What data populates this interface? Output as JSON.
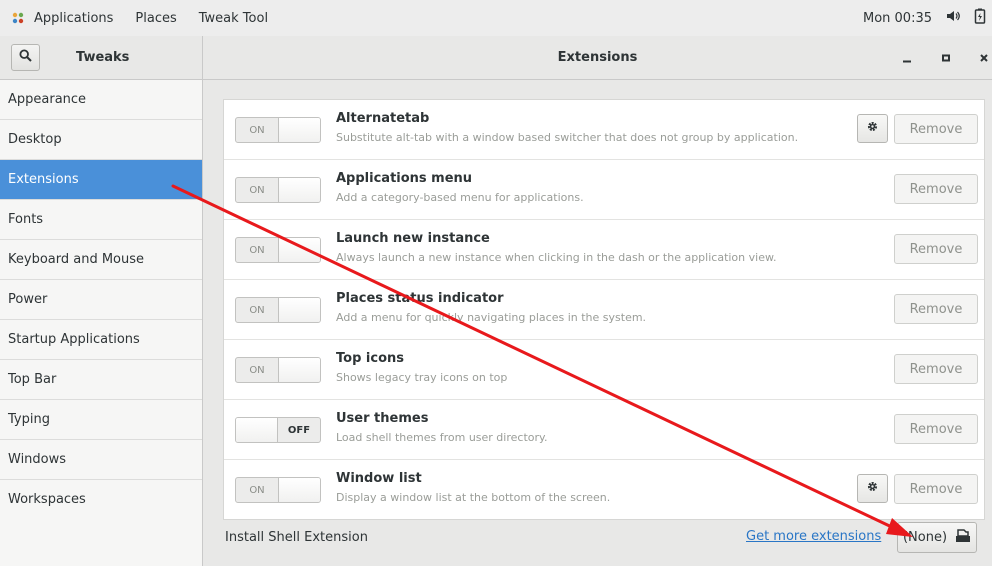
{
  "topbar": {
    "applications": "Applications",
    "places": "Places",
    "app_name": "Tweak Tool",
    "clock": "Mon 00:35",
    "icons": [
      "applications-icon",
      "volume-icon",
      "power-icon"
    ]
  },
  "header": {
    "sidebar_title": "Tweaks",
    "main_title": "Extensions",
    "minimize": "_",
    "maximize": "▫",
    "close": "×"
  },
  "sidebar": {
    "items": [
      {
        "label": "Appearance"
      },
      {
        "label": "Desktop"
      },
      {
        "label": "Extensions",
        "active": true
      },
      {
        "label": "Fonts"
      },
      {
        "label": "Keyboard and Mouse"
      },
      {
        "label": "Power"
      },
      {
        "label": "Startup Applications"
      },
      {
        "label": "Top Bar"
      },
      {
        "label": "Typing"
      },
      {
        "label": "Windows"
      },
      {
        "label": "Workspaces"
      }
    ]
  },
  "extensions": [
    {
      "name": "Alternatetab",
      "description": "Substitute alt-tab with a window based switcher that does not group by application.",
      "state": "ON",
      "has_settings": true,
      "remove_label": "Remove"
    },
    {
      "name": "Applications menu",
      "description": "Add a category-based menu for applications.",
      "state": "ON",
      "has_settings": false,
      "remove_label": "Remove"
    },
    {
      "name": "Launch new instance",
      "description": "Always launch a new instance when clicking in the dash or the application view.",
      "state": "ON",
      "has_settings": false,
      "remove_label": "Remove"
    },
    {
      "name": "Places status indicator",
      "description": "Add a menu for quickly navigating places in the system.",
      "state": "ON",
      "has_settings": false,
      "remove_label": "Remove"
    },
    {
      "name": "Top icons",
      "description": "Shows legacy tray icons on top",
      "state": "ON",
      "has_settings": false,
      "remove_label": "Remove"
    },
    {
      "name": "User themes",
      "description": "Load shell themes from user directory.",
      "state": "OFF",
      "has_settings": false,
      "remove_label": "Remove"
    },
    {
      "name": "Window list",
      "description": "Display a window list at the bottom of the screen.",
      "state": "ON",
      "has_settings": true,
      "remove_label": "Remove"
    }
  ],
  "install": {
    "label": "Install Shell Extension",
    "link": "Get more extensions",
    "file_button": "(None)"
  },
  "colors": {
    "selection": "#4a90d9",
    "link": "#2a76c6",
    "annotation_arrow": "#e8191c"
  }
}
